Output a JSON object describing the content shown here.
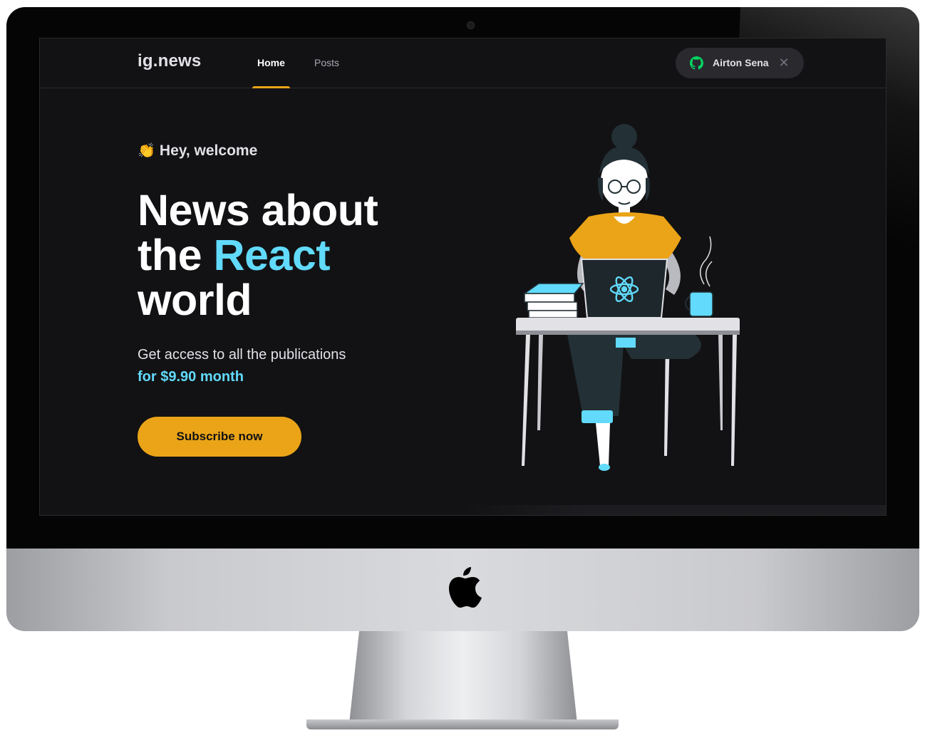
{
  "app": {
    "logo": "ig.news"
  },
  "nav": {
    "items": [
      {
        "label": "Home",
        "active": true
      },
      {
        "label": "Posts",
        "active": false
      }
    ]
  },
  "user_button": {
    "name": "Airton Sena",
    "icon": "github-icon",
    "close_icon": "close-icon",
    "close_glyph": "✕",
    "status_color": "#04d361"
  },
  "hero": {
    "wave_emoji": "👏",
    "welcome": "Hey, welcome",
    "headline_line1": "News about",
    "headline_line2_prefix": "the",
    "headline_accent": "React",
    "headline_line3": "world",
    "subtext": "Get access to all the publications",
    "price": "for $9.90 month",
    "cta_label": "Subscribe now"
  },
  "colors": {
    "background": "#121214",
    "accent_yellow": "#eba417",
    "accent_cyan": "#61dafb",
    "text": "#e1e1e6"
  }
}
